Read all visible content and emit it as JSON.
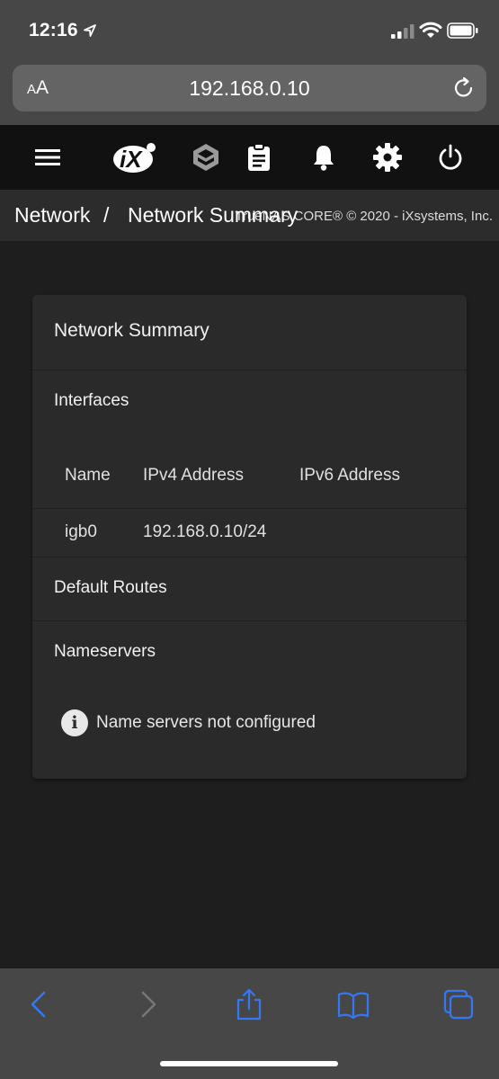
{
  "status_bar": {
    "time": "12:16"
  },
  "safari": {
    "text_size_small": "A",
    "text_size_big": "A",
    "url": "192.168.0.10"
  },
  "toolbar": {
    "icons": [
      "menu-icon",
      "ix-logo-icon",
      "truenas-cube-icon",
      "clipboard-icon",
      "bell-icon",
      "gear-icon",
      "power-icon"
    ]
  },
  "breadcrumb": {
    "items": [
      "Network",
      "Network Summary"
    ],
    "separator": "/",
    "copyright": "TrueNAS CORE® © 2020 - iXsystems, Inc."
  },
  "card": {
    "title": "Network Summary",
    "interfaces": {
      "title": "Interfaces",
      "columns": [
        "Name",
        "IPv4 Address",
        "IPv6 Address"
      ],
      "rows": [
        {
          "name": "igb0",
          "ipv4": "192.168.0.10/24",
          "ipv6": ""
        }
      ]
    },
    "default_routes": {
      "title": "Default Routes"
    },
    "nameservers": {
      "title": "Nameservers",
      "info_icon": "i",
      "message": "Name servers not configured"
    }
  },
  "colors": {
    "accent": "#3478f6",
    "toolbar_bg": "#111111",
    "page_bg": "#1e1e1e",
    "card_bg": "#2a2a2a"
  }
}
